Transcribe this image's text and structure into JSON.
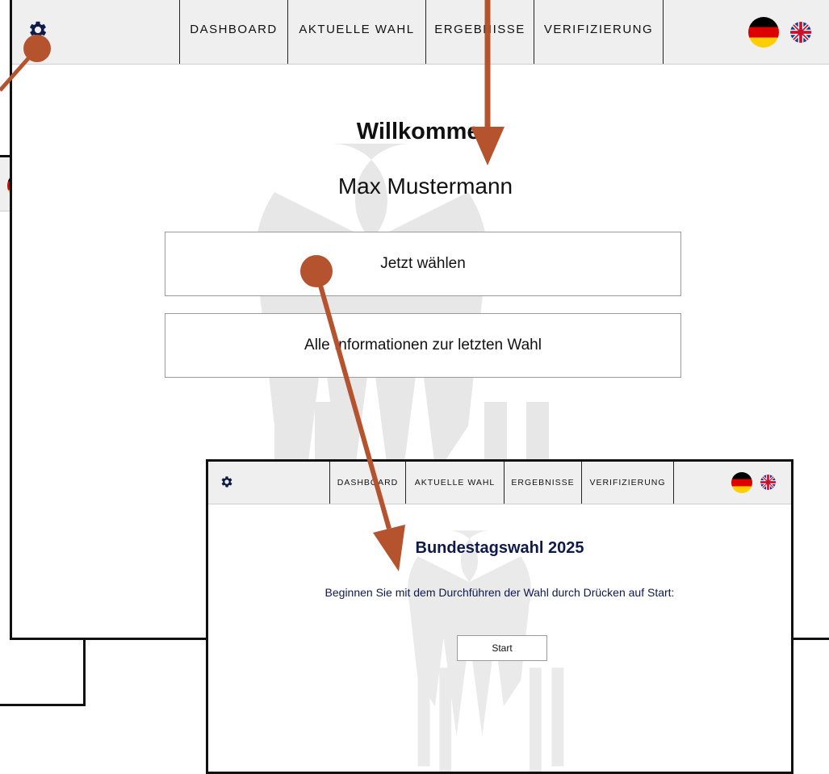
{
  "nav": {
    "items": [
      "DASHBOARD",
      "AKTUELLE WAHL",
      "ERGEBNISSE",
      "VERIFIZIERUNG"
    ]
  },
  "icons": {
    "settings": "gear-icon",
    "lang_de": "flag-germany-icon",
    "lang_en": "flag-uk-icon"
  },
  "dashboard": {
    "heading": "Willkommen",
    "username": "Max Mustermann",
    "vote_button": "Jetzt wählen",
    "info_button": "Alle Informationen zur letzten Wahl"
  },
  "election": {
    "title": "Bundestagswahl 2025",
    "instruction": "Beginnen Sie mit dem Durchführen der Wahl durch Drücken auf Start:",
    "start_button": "Start"
  },
  "colors": {
    "arrow": "#b5532f",
    "title_navy": "#0d1a4a",
    "bar_bg": "#efefef"
  }
}
